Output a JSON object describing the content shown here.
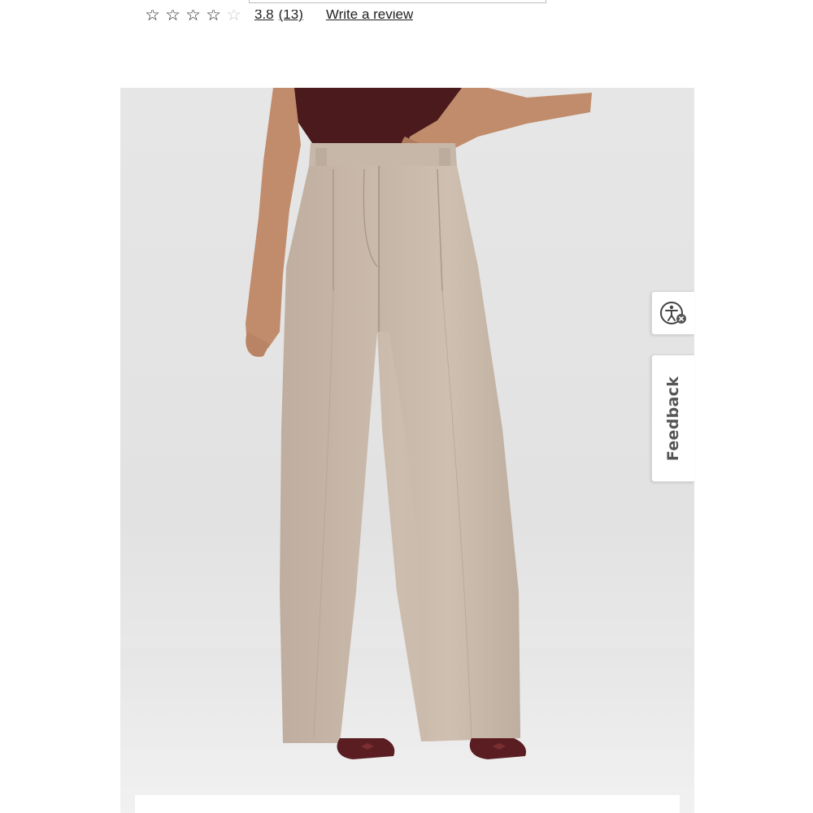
{
  "product": {
    "rating": {
      "stars_filled": 4,
      "stars_total": 5,
      "value_text": "3.8",
      "count_text": "(13)",
      "write_review_label": "Write a review"
    },
    "image_alt": "Woman wearing high waisted pleated wide leg trousers in oatmeal herringbone"
  },
  "widgets": {
    "accessibility_label": "",
    "feedback_label": "Feedback"
  },
  "colors": {
    "trouser": "#c9b9aa",
    "top": "#4a1a1c",
    "shoe": "#5a1e22",
    "skin": "#c08c6c",
    "backdrop": "#e4e4e4"
  },
  "icons": {
    "star": "star-icon",
    "accessibility": "accessibility-icon",
    "close_badge": "close-icon"
  }
}
